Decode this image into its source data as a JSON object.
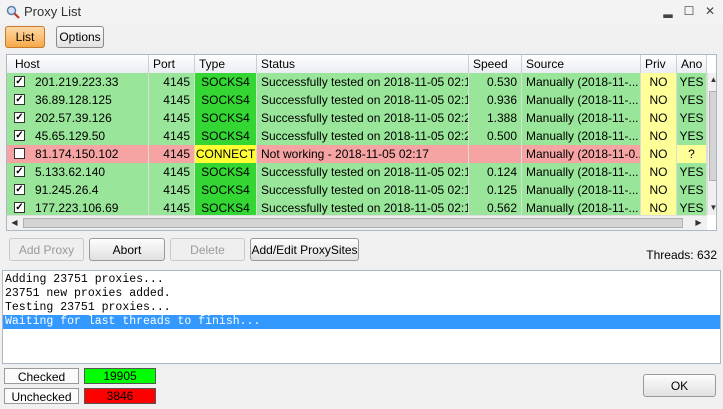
{
  "window": {
    "title": "Proxy List",
    "minimize_glyph": "▂",
    "maximize_glyph": "☐",
    "close_glyph": "✕"
  },
  "tabs": [
    {
      "label": "List",
      "active": true
    },
    {
      "label": "Options",
      "active": false
    }
  ],
  "table": {
    "columns": [
      "Host",
      "Port",
      "Type",
      "Status",
      "Speed",
      "Source",
      "Priv",
      "Ano"
    ],
    "rows": [
      {
        "checked": true,
        "host": "201.219.223.33",
        "port": "4145",
        "type": "SOCKS4",
        "status": "Successfully tested on 2018-11-05 02:1...",
        "speed": "0.530",
        "source": "Manually (2018-11-...",
        "priv": "NO",
        "ano": "YES",
        "state": "ok"
      },
      {
        "checked": true,
        "host": "36.89.128.125",
        "port": "4145",
        "type": "SOCKS4",
        "status": "Successfully tested on 2018-11-05 02:1...",
        "speed": "0.936",
        "source": "Manually (2018-11-...",
        "priv": "NO",
        "ano": "YES",
        "state": "ok"
      },
      {
        "checked": true,
        "host": "202.57.39.126",
        "port": "4145",
        "type": "SOCKS4",
        "status": "Successfully tested on 2018-11-05 02:2...",
        "speed": "1.388",
        "source": "Manually (2018-11-...",
        "priv": "NO",
        "ano": "YES",
        "state": "ok"
      },
      {
        "checked": true,
        "host": "45.65.129.50",
        "port": "4145",
        "type": "SOCKS4",
        "status": "Successfully tested on 2018-11-05 02:2...",
        "speed": "0.500",
        "source": "Manually (2018-11-...",
        "priv": "NO",
        "ano": "YES",
        "state": "ok"
      },
      {
        "checked": false,
        "host": "81.174.150.102",
        "port": "4145",
        "type": "CONNECT",
        "status": "Not working - 2018-11-05 02:17",
        "speed": "",
        "source": "Manually (2018-11-0...",
        "priv": "NO",
        "ano": "?",
        "state": "fail"
      },
      {
        "checked": true,
        "host": "5.133.62.140",
        "port": "4145",
        "type": "SOCKS4",
        "status": "Successfully tested on 2018-11-05 02:1...",
        "speed": "0.124",
        "source": "Manually (2018-11-...",
        "priv": "NO",
        "ano": "YES",
        "state": "ok"
      },
      {
        "checked": true,
        "host": "91.245.26.4",
        "port": "4145",
        "type": "SOCKS4",
        "status": "Successfully tested on 2018-11-05 02:1...",
        "speed": "0.125",
        "source": "Manually (2018-11-...",
        "priv": "NO",
        "ano": "YES",
        "state": "ok"
      },
      {
        "checked": true,
        "host": "177.223.106.69",
        "port": "4145",
        "type": "SOCKS4",
        "status": "Successfully tested on 2018-11-05 02:1...",
        "speed": "0.562",
        "source": "Manually (2018-11-...",
        "priv": "NO",
        "ano": "YES",
        "state": "ok"
      }
    ]
  },
  "buttons": {
    "add_proxy": "Add Proxy",
    "abort": "Abort",
    "delete": "Delete",
    "add_edit_proxysites": "Add/Edit ProxySites"
  },
  "threads_label": "Threads: 632",
  "log": [
    "Adding 23751 proxies...",
    "23751 new proxies added.",
    "Testing 23751 proxies...",
    "Waiting for last threads to finish..."
  ],
  "stats": {
    "checked_label": "Checked",
    "checked_value": "19905",
    "unchecked_label": "Unchecked",
    "unchecked_value": "3846"
  },
  "ok_label": "OK",
  "colors": {
    "ok_row": "#99e599",
    "fail_row": "#f5a3a3",
    "type_socks": "#33d633",
    "type_connect": "#ffff33",
    "priv": "#ffff99",
    "checked_bar": "#00ff00",
    "unchecked_bar": "#ff0000",
    "log_selection": "#3399ff",
    "active_tab": "#f6a94a"
  }
}
